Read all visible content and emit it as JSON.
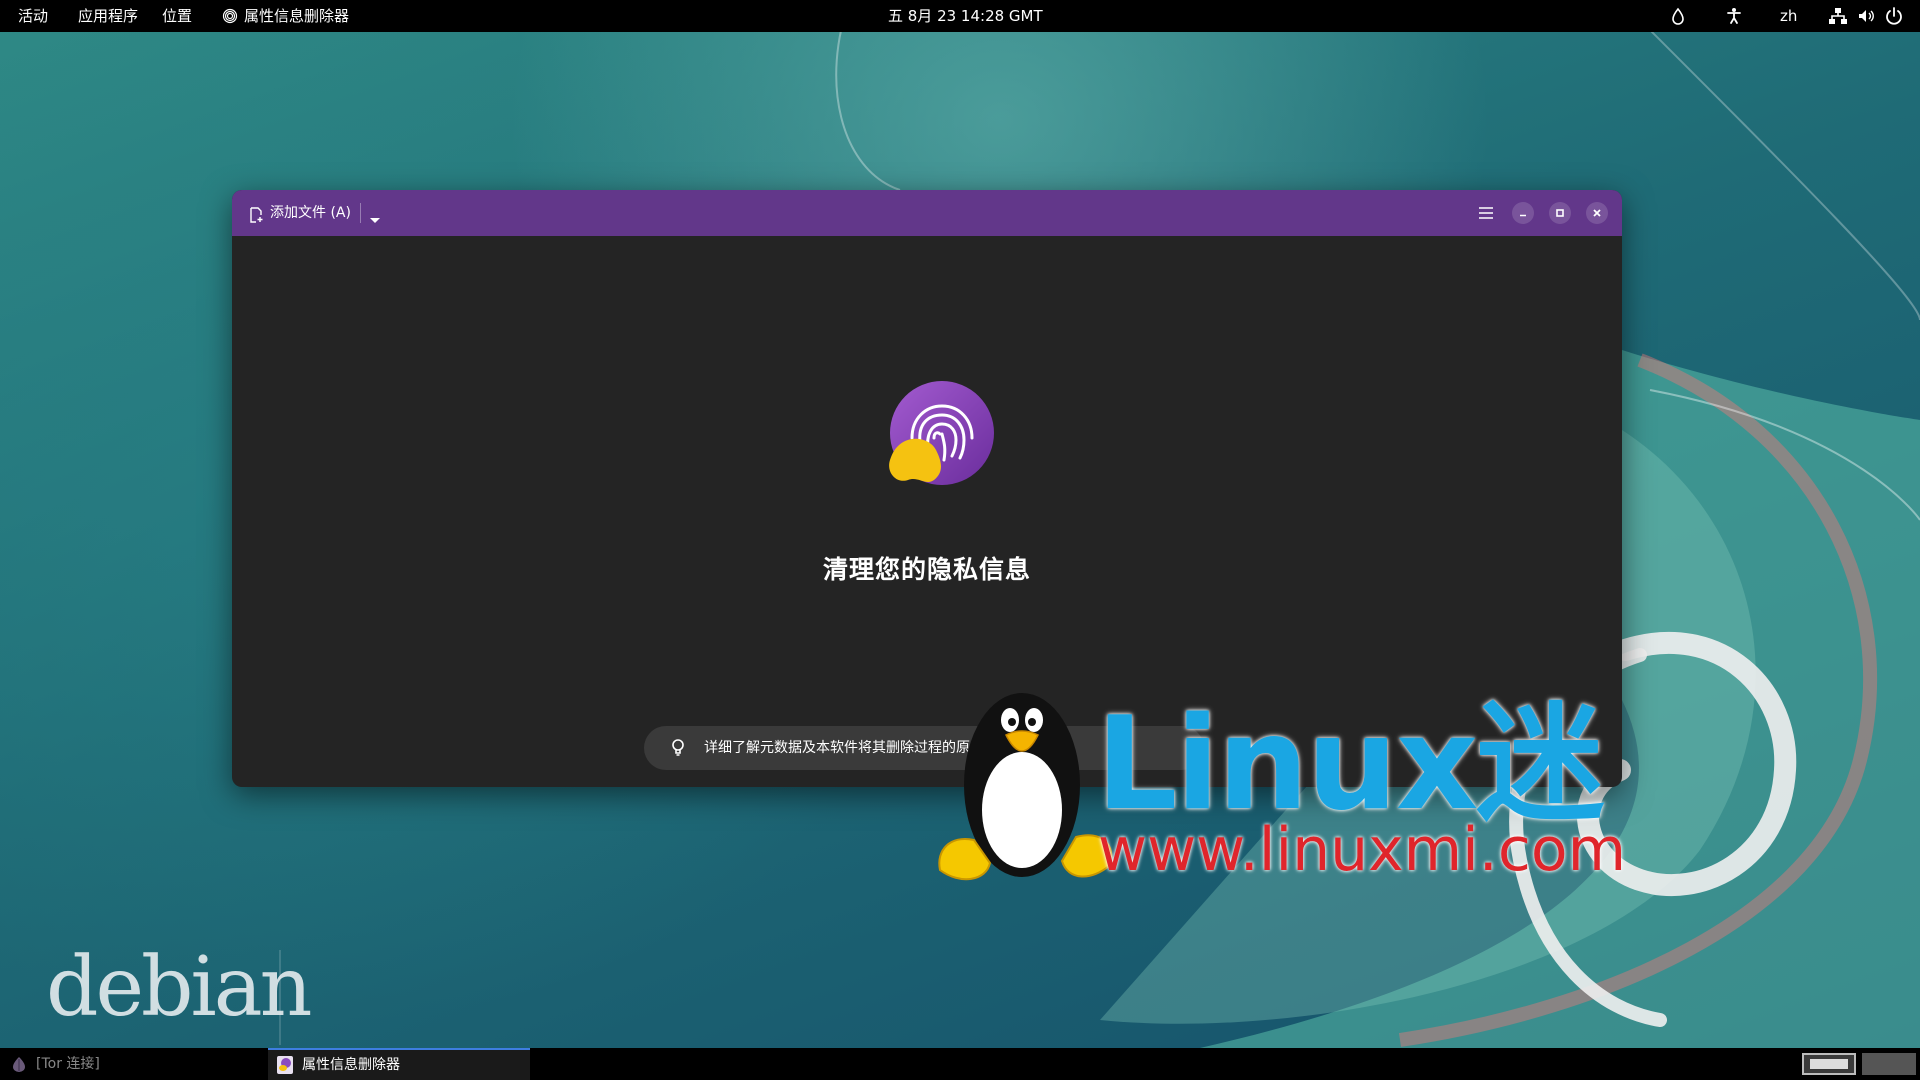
{
  "topbar": {
    "activities": "活动",
    "applications": "应用程序",
    "places": "位置",
    "app_name": "属性信息删除器",
    "datetime": "五 8月 23  14:28 GMT",
    "language": "zh"
  },
  "window": {
    "add_file_label": "添加文件 (A)",
    "headline": "清理您的隐私信息",
    "info_text": "详细了解元数据及本软件将其删除过程的原",
    "headerbar_color": "#62378a"
  },
  "desktop": {
    "watermark_brand": "Linux迷",
    "watermark_url": "www.linuxmi.com",
    "debian_text": "debian"
  },
  "bottombar": {
    "tor_label": "[Tor 连接]",
    "task_label": "属性信息删除器"
  }
}
